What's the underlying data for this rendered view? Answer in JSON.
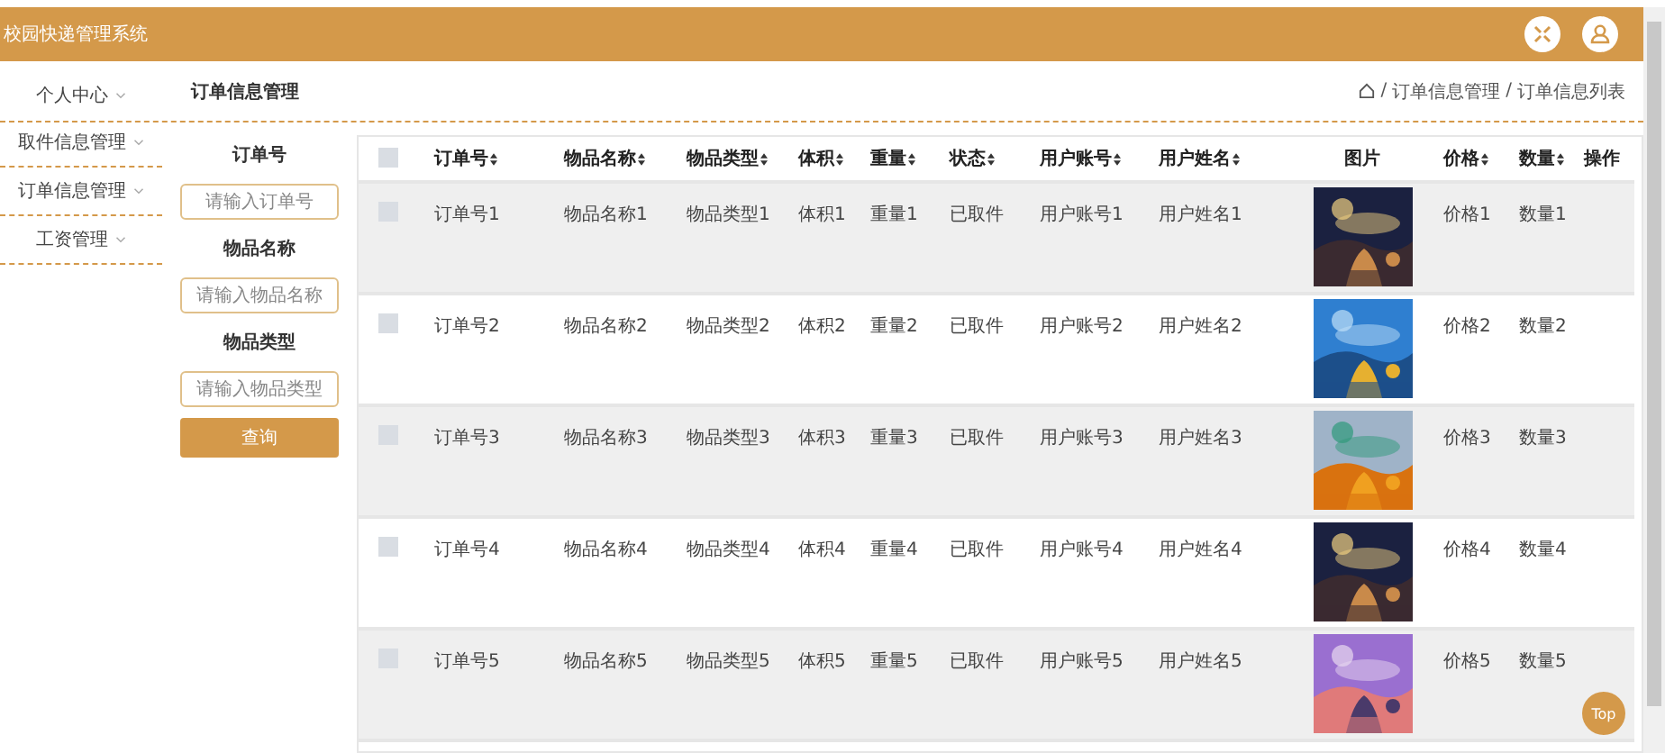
{
  "header": {
    "title": "校园快递管理系统"
  },
  "sidebar": {
    "items": [
      {
        "label": "个人中心"
      },
      {
        "label": "取件信息管理"
      },
      {
        "label": "订单信息管理"
      },
      {
        "label": "工资管理"
      }
    ]
  },
  "page_title": "订单信息管理",
  "breadcrumb": [
    {
      "separator": "/",
      "label": "订单信息管理"
    },
    {
      "separator": "/",
      "label": "订单信息列表"
    }
  ],
  "search": {
    "fields": [
      {
        "label": "订单号",
        "placeholder": "请输入订单号"
      },
      {
        "label": "物品名称",
        "placeholder": "请输入物品名称"
      },
      {
        "label": "物品类型",
        "placeholder": "请输入物品类型"
      }
    ],
    "button": "查询"
  },
  "table": {
    "all_checked": false,
    "columns": [
      {
        "label": "订单号",
        "sortable": true
      },
      {
        "label": "物品名称",
        "sortable": true
      },
      {
        "label": "物品类型",
        "sortable": true
      },
      {
        "label": "体积",
        "sortable": true
      },
      {
        "label": "重量",
        "sortable": true
      },
      {
        "label": "状态",
        "sortable": true
      },
      {
        "label": "用户账号",
        "sortable": true
      },
      {
        "label": "用户姓名",
        "sortable": true
      },
      {
        "label": "图片",
        "sortable": false
      },
      {
        "label": "价格",
        "sortable": true
      },
      {
        "label": "数量",
        "sortable": true
      },
      {
        "label": "操作",
        "sortable": false
      }
    ],
    "rows": [
      {
        "checked": false,
        "cells": [
          "订单号1",
          "物品名称1",
          "物品类型1",
          "体积1",
          "重量1",
          "已取件",
          "用户账号1",
          "用户姓名1",
          {
            "kind": "picture"
          },
          "价格1",
          "数量1",
          ""
        ]
      },
      {
        "checked": false,
        "cells": [
          "订单号2",
          "物品名称2",
          "物品类型2",
          "体积2",
          "重量2",
          "已取件",
          "用户账号2",
          "用户姓名2",
          {
            "kind": "picture"
          },
          "价格2",
          "数量2",
          ""
        ]
      },
      {
        "checked": false,
        "cells": [
          "订单号3",
          "物品名称3",
          "物品类型3",
          "体积3",
          "重量3",
          "已取件",
          "用户账号3",
          "用户姓名3",
          {
            "kind": "picture"
          },
          "价格3",
          "数量3",
          ""
        ]
      },
      {
        "checked": false,
        "cells": [
          "订单号4",
          "物品名称4",
          "物品类型4",
          "体积4",
          "重量4",
          "已取件",
          "用户账号4",
          "用户姓名4",
          {
            "kind": "picture"
          },
          "价格4",
          "数量4",
          ""
        ]
      },
      {
        "checked": false,
        "cells": [
          "订单号5",
          "物品名称5",
          "物品类型5",
          "体积5",
          "重量5",
          "已取件",
          "用户账号5",
          "用户姓名5",
          {
            "kind": "picture"
          },
          "价格5",
          "数量5",
          ""
        ]
      }
    ]
  },
  "back_to_top": "Top"
}
